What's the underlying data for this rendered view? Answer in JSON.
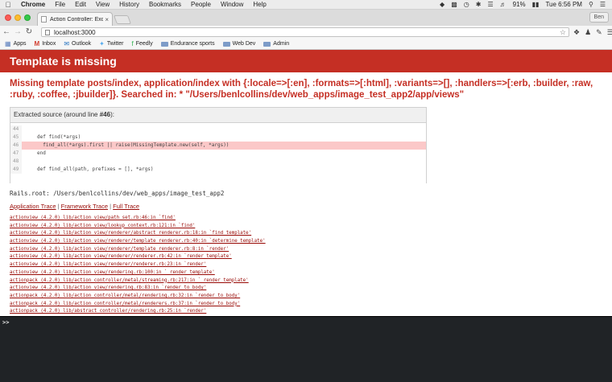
{
  "menubar": {
    "app": "Chrome",
    "items": [
      "File",
      "Edit",
      "View",
      "History",
      "Bookmarks",
      "People",
      "Window",
      "Help"
    ],
    "battery": "91%",
    "clock": "Tue 6:56 PM"
  },
  "browser": {
    "tab_title": "Action Controller: Exceptio",
    "profile": "Ben",
    "url": "localhost:3000"
  },
  "bookmarks": [
    {
      "label": "Apps",
      "icon": "apps-grid-icon"
    },
    {
      "label": "Inbox",
      "icon": "gmail-icon"
    },
    {
      "label": "Outlook",
      "icon": "outlook-icon"
    },
    {
      "label": "Twitter",
      "icon": "twitter-icon"
    },
    {
      "label": "Feedly",
      "icon": "feedly-icon"
    },
    {
      "label": "Endurance sports",
      "icon": "folder-icon"
    },
    {
      "label": "Web Dev",
      "icon": "folder-icon"
    },
    {
      "label": "Admin",
      "icon": "folder-icon"
    }
  ],
  "page": {
    "header": "Template is missing",
    "error": "Missing template posts/index, application/index with {:locale=>[:en], :formats=>[:html], :variants=>[], :handlers=>[:erb, :builder, :raw, :ruby, :coffee, :jbuilder]}. Searched in: * \"/Users/benlcollins/dev/web_apps/image_test_app2/app/views\"",
    "source_title": "Extracted source (around line ",
    "source_line": "#46",
    "source_title_end": "):",
    "code": [
      {
        "n": "44",
        "text": "",
        "hl": false
      },
      {
        "n": "45",
        "text": "def find(*args)",
        "hl": false
      },
      {
        "n": "46",
        "text": "  find_all(*args).first || raise(MissingTemplate.new(self, *args))",
        "hl": true
      },
      {
        "n": "47",
        "text": "end",
        "hl": false
      },
      {
        "n": "48",
        "text": "",
        "hl": false
      },
      {
        "n": "49",
        "text": "def find_all(path, prefixes = [], *args)",
        "hl": false
      }
    ],
    "rails_root": "Rails.root: /Users/benlcollins/dev/web_apps/image_test_app2",
    "trace_links": [
      "Application Trace",
      "Framework Trace",
      "Full Trace"
    ],
    "trace_sep": " | ",
    "trace": [
      "actionview (4.2.0) lib/action_view/path_set.rb:46:in `find'",
      "actionview (4.2.0) lib/action_view/lookup_context.rb:121:in `find'",
      "actionview (4.2.0) lib/action_view/renderer/abstract_renderer.rb:18:in `find_template'",
      "actionview (4.2.0) lib/action_view/renderer/template_renderer.rb:40:in `determine_template'",
      "actionview (4.2.0) lib/action_view/renderer/template_renderer.rb:8:in `render'",
      "actionview (4.2.0) lib/action_view/renderer/renderer.rb:42:in `render_template'",
      "actionview (4.2.0) lib/action_view/renderer/renderer.rb:23:in `render'",
      "actionview (4.2.0) lib/action_view/rendering.rb:100:in `_render_template'",
      "actionpack (4.2.0) lib/action_controller/metal/streaming.rb:217:in `_render_template'",
      "actionview (4.2.0) lib/action_view/rendering.rb:83:in `render_to_body'",
      "actionpack (4.2.0) lib/action_controller/metal/rendering.rb:32:in `render_to_body'",
      "actionpack (4.2.0) lib/action_controller/metal/renderers.rb:37:in `render_to_body'",
      "actionpack (4.2.0) lib/abstract_controller/rendering.rb:25:in `render'"
    ]
  },
  "terminal": {
    "prompt": ">>"
  }
}
